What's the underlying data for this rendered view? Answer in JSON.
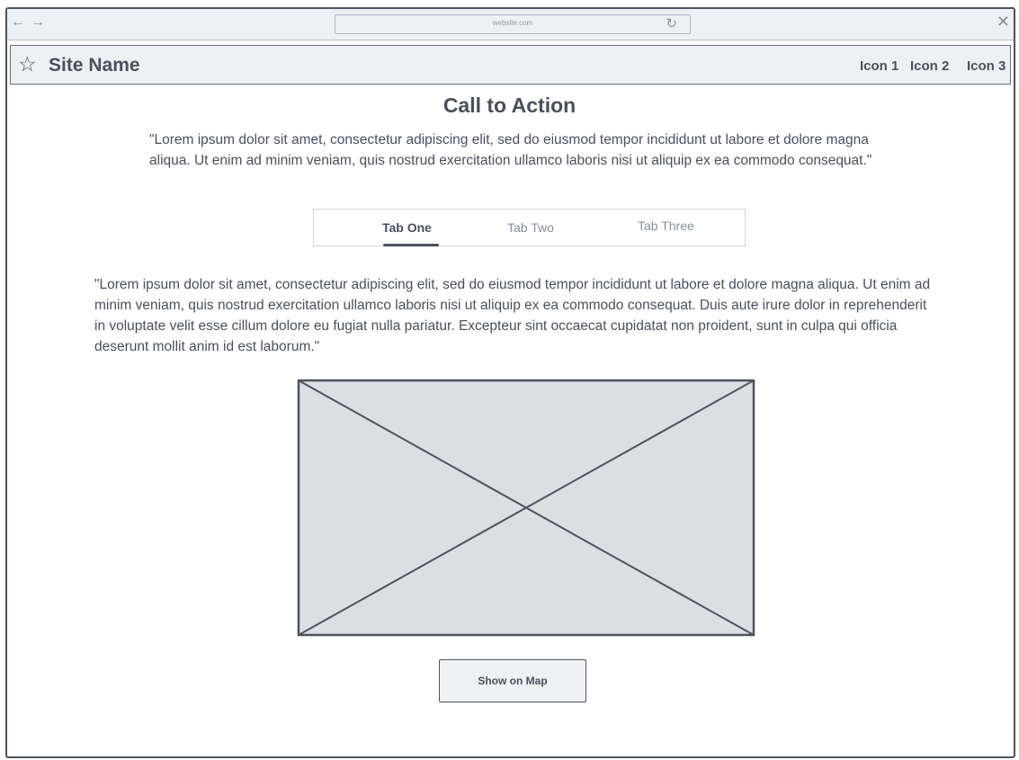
{
  "browser": {
    "url": "website.com",
    "back_icon": "←",
    "forward_icon": "→",
    "reload_icon": "↻",
    "close_icon": "✕"
  },
  "header": {
    "logo_icon": "☆",
    "site_name": "Site Name",
    "icons": [
      "Icon 1",
      "Icon 2",
      "Icon 3"
    ]
  },
  "main": {
    "title": "Call to Action",
    "intro": "\"Lorem ipsum dolor sit amet, consectetur adipiscing elit, sed do eiusmod tempor incididunt ut labore et dolore magna aliqua. Ut enim ad minim veniam, quis nostrud exercitation ullamco laboris nisi ut aliquip ex ea commodo consequat.\"",
    "tabs": [
      {
        "label": "Tab One",
        "active": true
      },
      {
        "label": "Tab Two",
        "active": false
      },
      {
        "label": "Tab Three",
        "active": false
      }
    ],
    "body": "\"Lorem ipsum dolor sit amet, consectetur adipiscing elit, sed do eiusmod tempor incididunt ut labore et dolore magna aliqua. Ut enim ad minim veniam, quis nostrud exercitation ullamco laboris nisi ut aliquip ex ea commodo consequat. Duis aute irure dolor in reprehenderit in voluptate velit esse cillum dolore eu fugiat nulla pariatur. Excepteur sint occaecat cupidatat non proident, sunt in culpa qui officia deserunt mollit anim id est laborum.\"",
    "map_button": "Show on Map"
  },
  "colors": {
    "ink": "#4a4f5c",
    "chrome_bg": "#eef0f3",
    "placeholder_bg": "#dcdee2"
  }
}
